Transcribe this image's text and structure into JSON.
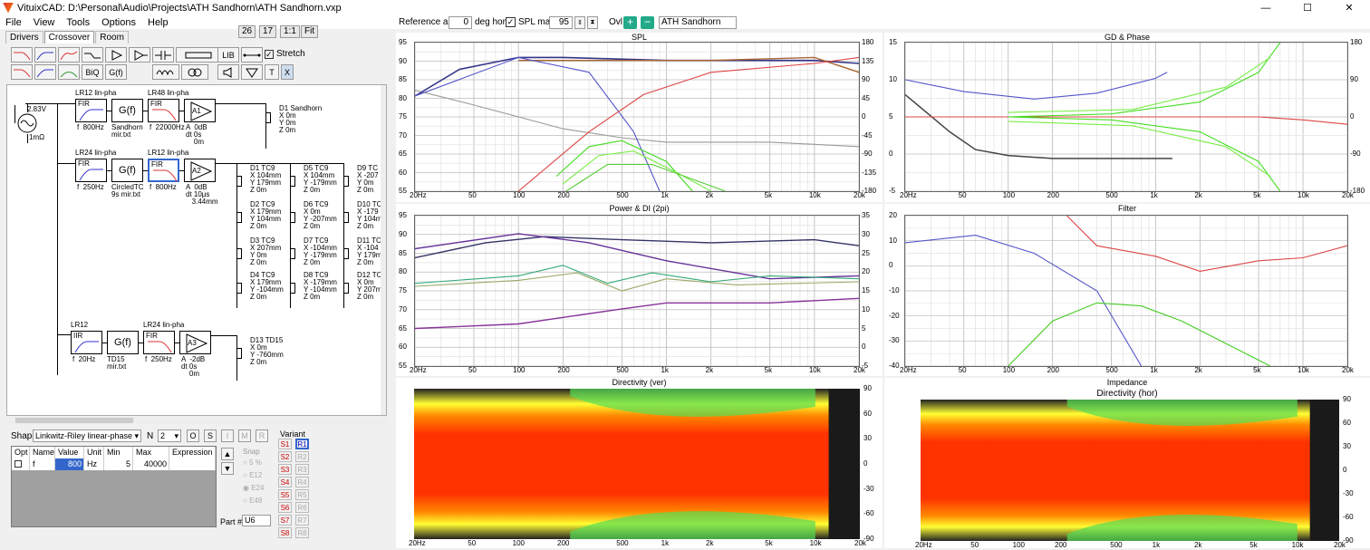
{
  "window": {
    "title": "VituixCAD: D:\\Personal\\Audio\\Projects\\ATH Sandhorn\\ATH Sandhorn.vxp",
    "min": "—",
    "max": "☐",
    "close": "✕"
  },
  "menu": [
    "File",
    "View",
    "Tools",
    "Options",
    "Help"
  ],
  "tabs": [
    "Drivers",
    "Crossover",
    "Room"
  ],
  "zoom": [
    "26",
    "17",
    "1:1",
    "Fit"
  ],
  "toolbar": {
    "lib": "LIB",
    "biq": "BiQ",
    "gf": "G(f)",
    "t": "T",
    "x": "X",
    "stretch": "Stretch"
  },
  "top_controls": {
    "ref_angle_label": "Reference angle",
    "ref_angle_value": "0",
    "ref_angle_unit": "deg hor",
    "spl_max_label": "SPL max",
    "spl_max_value": "95",
    "ovl_label": "Ovl",
    "ovl_name": "ATH Sandhorn"
  },
  "schematic": {
    "gen_voltage": "2.83V",
    "gen_res": "1mΩ",
    "blocks": [
      {
        "title": "LR12 lin-pha",
        "type": "FIR",
        "param": "f  800Hz"
      },
      {
        "title": "",
        "type": "G(f)",
        "param": "Sandhorn\nmir.txt"
      },
      {
        "title": "LR48 lin-pha",
        "type": "FIR",
        "param": "f  22000Hz"
      },
      {
        "title": "",
        "type": "A1",
        "param": "A  0dB\ndt 0s\n    0m"
      },
      {
        "title": "LR24 lin-pha",
        "type": "FIR",
        "param": "f  250Hz"
      },
      {
        "title": "",
        "type": "G(f)",
        "param": "CircledTC\n9s mir.txt"
      },
      {
        "title": "LR12 lin-pha",
        "type": "FIR",
        "param": "f  800Hz"
      },
      {
        "title": "",
        "type": "A2",
        "param": "A  0dB\ndt 10µs\n   3.44mm"
      },
      {
        "title": "LR12",
        "type": "IIR",
        "param": "f  20Hz"
      },
      {
        "title": "",
        "type": "G(f)",
        "param": "TD15\nmir.txt"
      },
      {
        "title": "LR24 lin-pha",
        "type": "FIR",
        "param": "f  250Hz"
      },
      {
        "title": "",
        "type": "A3",
        "param": "A  -2dB\ndt 0s\n    0m"
      }
    ],
    "drivers": [
      "D1 Sandhorn\nX 0m\nY 0m\nZ 0m",
      "D1 TC9\nX 104mm\nY 179mm\nZ 0m",
      "D2 TC9\nX 179mm\nY 104mm\nZ 0m",
      "D3 TC9\nX 207mm\nY 0m\nZ 0m",
      "D4 TC9\nX 179mm\nY -104mm\nZ 0m",
      "D5 TC9\nX 104mm\nY -179mm\nZ 0m",
      "D6 TC9\nX 0m\nY -207mm\nZ 0m",
      "D7 TC9\nX -104mm\nY -179mm\nZ 0m",
      "D8 TC9\nX -179mm\nY -104mm\nZ 0m",
      "D9 TC\nX -207\nY 0m\nZ 0m",
      "D10 TC\nX -179\nY 104m\nZ 0m",
      "D11 TC\nX -104\nY 179m\nZ 0m",
      "D12 TC\nX 0m\nY 207m\nZ 0m",
      "D13 TD15\nX 0m\nY -760mm\nZ 0m"
    ]
  },
  "shape": {
    "label": "Shape",
    "value": "Linkwitz-Riley linear-phase",
    "n_label": "N",
    "n_value": "2",
    "btn_o": "O",
    "btn_s": "S",
    "btn_i": "I",
    "btn_m": "M",
    "btn_r": "R"
  },
  "param_table": {
    "headers": [
      "Opt",
      "Name",
      "Value",
      "Unit",
      "Min",
      "Max",
      "Expression"
    ],
    "row": [
      "",
      "f",
      "800",
      "Hz",
      "5",
      "40000",
      ""
    ]
  },
  "snap": {
    "label": "Snap",
    "options": [
      "5 %",
      "E12",
      "E24",
      "E48"
    ],
    "part_label": "Part #",
    "part_value": "U6"
  },
  "variant": {
    "label": "Variant",
    "s": [
      "S1",
      "S2",
      "S3",
      "S4",
      "S5",
      "S6",
      "S7",
      "S8"
    ],
    "r": [
      "R1",
      "R2",
      "R3",
      "R4",
      "R5",
      "R6",
      "R7",
      "R8"
    ]
  },
  "freq_ticks": [
    "20Hz",
    "50",
    "100",
    "200",
    "500",
    "1k",
    "2k",
    "5k",
    "10k",
    "20k"
  ],
  "panels": {
    "spl": {
      "title": "SPL",
      "y_left": [
        "95",
        "90",
        "85",
        "80",
        "75",
        "70",
        "65",
        "60",
        "55"
      ],
      "y_right": [
        "180",
        "135",
        "90",
        "45",
        "0",
        "-45",
        "-90",
        "-135",
        "-180"
      ],
      "unit_l": "dB",
      "unit_r": "deg"
    },
    "gd": {
      "title": "GD & Phase",
      "y_left": [
        "15",
        "10",
        "5",
        "0",
        "-5"
      ],
      "y_right": [
        "180",
        "90",
        "0",
        "-90",
        "-180"
      ],
      "unit_l": "ms",
      "unit_r": "deg"
    },
    "power": {
      "title": "Power & DI (2pi)",
      "y_left": [
        "95",
        "90",
        "85",
        "80",
        "75",
        "70",
        "65",
        "60",
        "55"
      ],
      "y_right": [
        "35",
        "30",
        "25",
        "20",
        "15",
        "10",
        "5",
        "0",
        "-5"
      ],
      "unit_l": "dB",
      "unit_r": "dB"
    },
    "filter": {
      "title": "Filter",
      "y_left": [
        "20",
        "10",
        "0",
        "-10",
        "-20",
        "-30",
        "-40"
      ],
      "unit_l": "dB"
    },
    "dir_ver": {
      "title": "Directivity (ver)",
      "y_right": [
        "90",
        "60",
        "30",
        "0",
        "-30",
        "-60",
        "-90"
      ],
      "unit_r": "deg",
      "colorbar": [
        "0",
        "-8",
        "-16",
        "-24",
        "-32",
        "-40",
        "-48"
      ]
    },
    "impedance": {
      "title": "Impedance",
      "sub": "Directivity (hor)",
      "y_right": [
        "90",
        "60",
        "30",
        "0",
        "-30",
        "-60",
        "-90"
      ],
      "colorbar": [
        "8",
        "0",
        "-8",
        "-16",
        "-24",
        "-32",
        "-40",
        "-48"
      ]
    }
  }
}
